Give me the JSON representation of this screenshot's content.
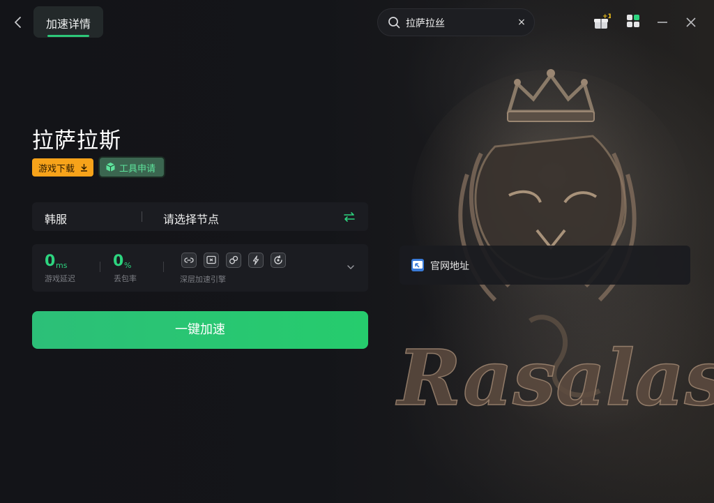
{
  "topbar": {
    "back_icon": "chevron-left-icon",
    "tab_label": "加速详情",
    "search": {
      "value": "拉萨拉丝",
      "icon": "search-icon",
      "clear_icon": "close-icon",
      "clear_glyph": "×"
    },
    "gift_badge": "+1",
    "icons": [
      "gift-icon",
      "apps-grid-icon",
      "minimize-icon",
      "close-icon"
    ]
  },
  "game": {
    "title": "拉萨拉斯",
    "download_label": "游戏下载",
    "tool_label": "工具申请"
  },
  "node": {
    "region": "韩服",
    "placeholder": "请选择节点"
  },
  "stats": {
    "latency": {
      "value": "0",
      "unit": "ms",
      "label": "游戏延迟"
    },
    "loss": {
      "value": "0",
      "unit": "%",
      "label": "丢包率"
    },
    "engine_label": "深层加速引擎",
    "engine_icons": [
      "link-icon",
      "screen-icon",
      "connect-icon",
      "lightning-icon",
      "refresh-icon"
    ]
  },
  "boost_label": "一键加速",
  "official_site_label": "官网地址",
  "background_text": "Rasalas",
  "colors": {
    "accent_green": "#2dd47f",
    "download_orange": "#f7a31a",
    "background": "#141519"
  }
}
